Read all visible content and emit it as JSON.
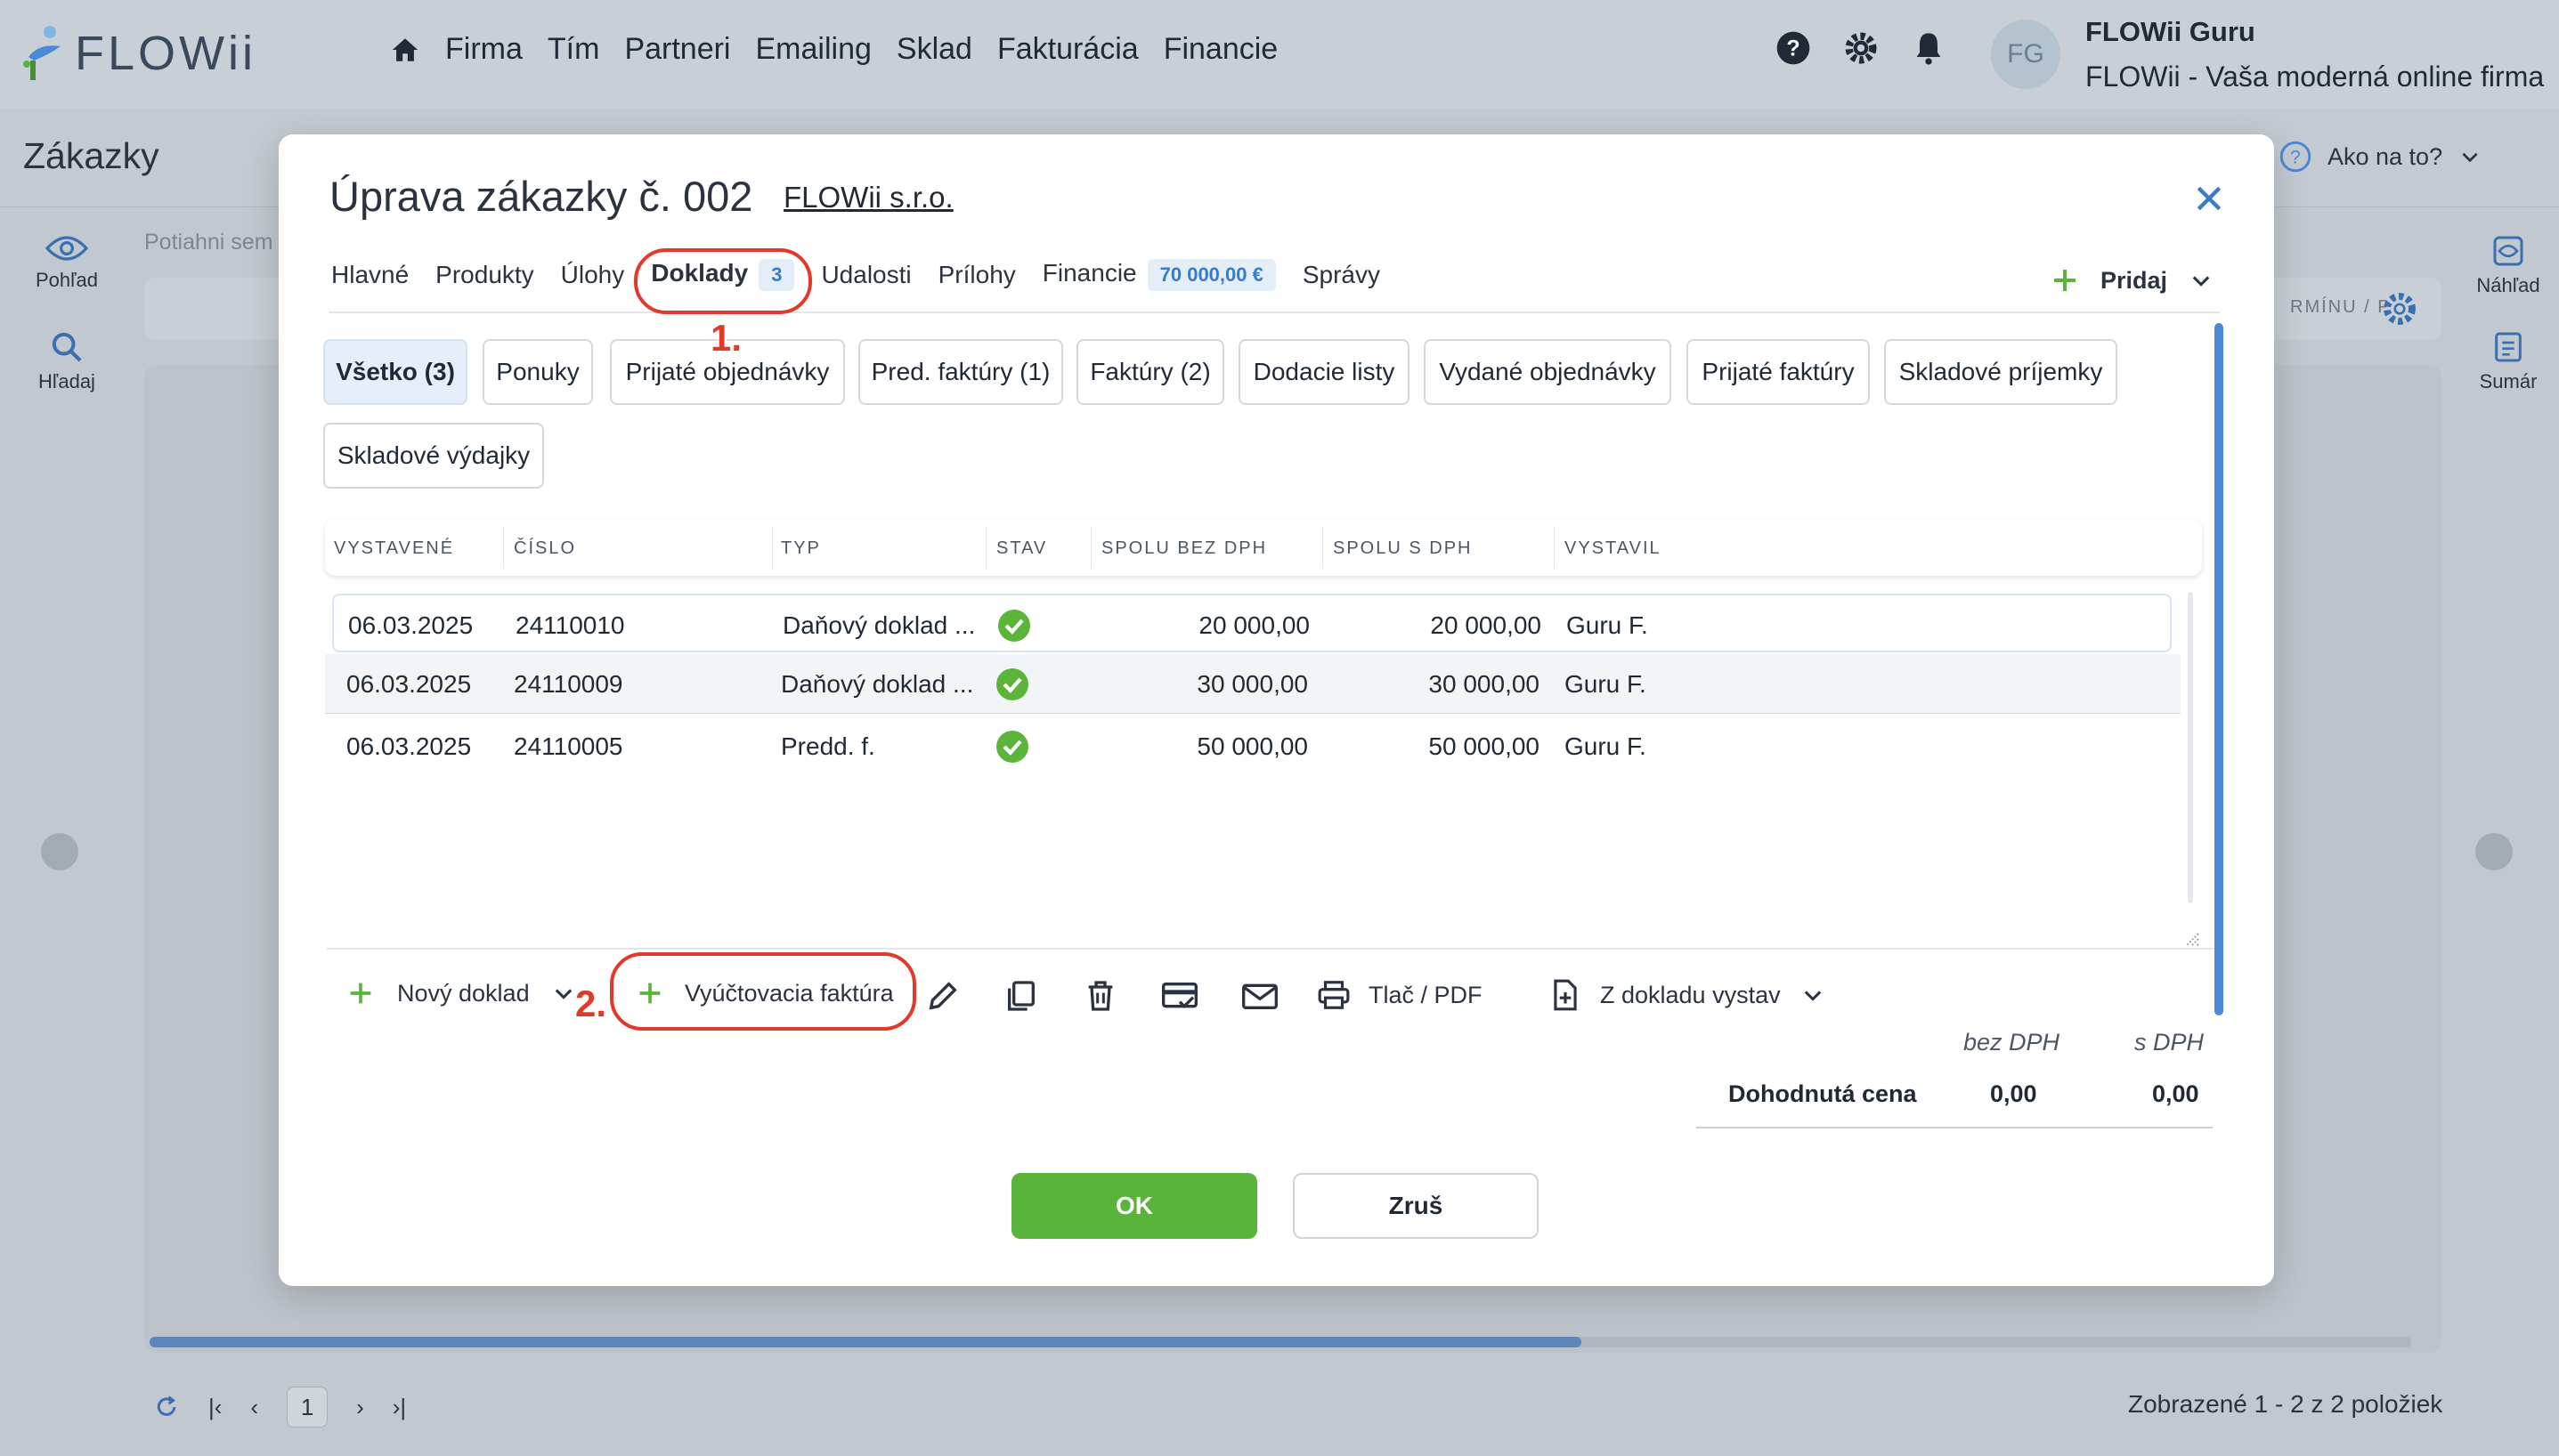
{
  "app": {
    "logo_text": "FLOWii",
    "nav": [
      "Firma",
      "Tím",
      "Partneri",
      "Emailing",
      "Sklad",
      "Fakturácia",
      "Financie"
    ],
    "user_initials": "FG",
    "user_name": "FLOWii Guru",
    "user_company": "FLOWii - Vaša moderná online firma",
    "page_title": "Zákazky",
    "help_label": "Ako na to?",
    "hint_text": "Potiahni sem",
    "side_left": [
      "Pohľad",
      "Hľadaj"
    ],
    "side_right": [
      "Náhľad",
      "Sumár"
    ],
    "toolbar_suffix": "RMÍNU / P",
    "pager_page": "1",
    "status": "Zobrazené 1 - 2 z 2 položiek"
  },
  "modal": {
    "title": "Úprava zákazky č. 002",
    "company": "FLOWii s.r.o.",
    "tabs": [
      {
        "label": "Hlavné"
      },
      {
        "label": "Produkty"
      },
      {
        "label": "Úlohy"
      },
      {
        "label": "Doklady",
        "badge": "3",
        "active": true
      },
      {
        "label": "Udalosti"
      },
      {
        "label": "Prílohy"
      },
      {
        "label": "Financie",
        "badge": "70 000,00 €"
      },
      {
        "label": "Správy"
      }
    ],
    "add_label": "Pridaj",
    "filters": [
      "Všetko (3)",
      "Ponuky",
      "Prijaté objednávky",
      "Pred. faktúry (1)",
      "Faktúry (2)",
      "Dodacie listy",
      "Vydané objednávky",
      "Prijaté faktúry",
      "Skladové príjemky",
      "Skladové výdajky"
    ],
    "columns": [
      "VYSTAVENÉ",
      "ČÍSLO",
      "TYP",
      "STAV",
      "SPOLU BEZ DPH",
      "SPOLU S DPH",
      "VYSTAVIL"
    ],
    "rows": [
      {
        "date": "06.03.2025",
        "number": "24110010",
        "type": "Daňový doklad ...",
        "without_vat": "20 000,00",
        "with_vat": "20 000,00",
        "issued_by": "Guru F."
      },
      {
        "date": "06.03.2025",
        "number": "24110009",
        "type": "Daňový doklad ...",
        "without_vat": "30 000,00",
        "with_vat": "30 000,00",
        "issued_by": "Guru F."
      },
      {
        "date": "06.03.2025",
        "number": "24110005",
        "type": "Predd. f.",
        "without_vat": "50 000,00",
        "with_vat": "50 000,00",
        "issued_by": "Guru F."
      }
    ],
    "actions": {
      "new_doc": "Nový doklad",
      "settlement_invoice": "Vyúčtovacia faktúra",
      "print": "Tlač / PDF",
      "from_doc": "Z dokladu vystav"
    },
    "totals": {
      "head_without": "bez DPH",
      "head_with": "s DPH",
      "label": "Dohodnutá cena",
      "without_vat": "0,00",
      "with_vat": "0,00"
    },
    "ok_label": "OK",
    "cancel_label": "Zruš"
  },
  "annotations": {
    "step1": "1.",
    "step2": "2.",
    "color": "#e23a2a"
  },
  "colors": {
    "accent_green": "#5ab43b",
    "accent_blue": "#4a8ad6",
    "highlight_red": "#e23a2a"
  }
}
